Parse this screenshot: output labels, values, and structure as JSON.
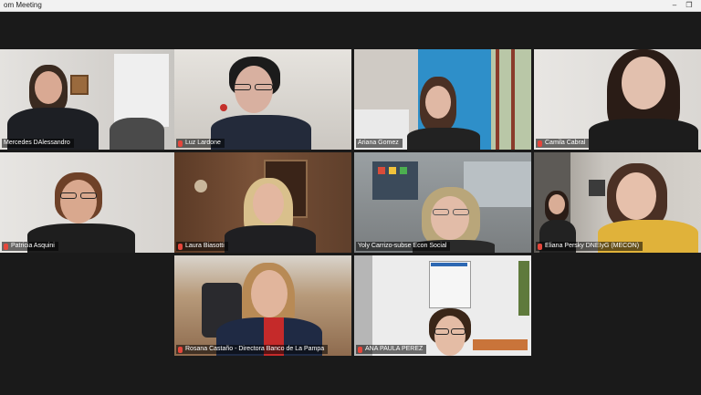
{
  "window": {
    "title": "om Meeting",
    "minimize": "–",
    "restore": "❐"
  },
  "participants": [
    {
      "name": "Mercedes DAlessandro"
    },
    {
      "name": "Luz Lardone"
    },
    {
      "name": "Ariana Gomez"
    },
    {
      "name": "Camila Cabral"
    },
    {
      "name": "Patricia Asquini"
    },
    {
      "name": "Laura Biasotti"
    },
    {
      "name": "Yoly Carrizo-subse Econ Social"
    },
    {
      "name": "Eliana Persky DNEIyG (MECON)"
    },
    {
      "name": "Rosana Castaño - Directora Banco de La Pampa"
    },
    {
      "name": "ANA PAULA PEREZ"
    }
  ],
  "colors": {
    "active_speaker_border": "#b7e04a",
    "muted_mic": "#e5463b",
    "background": "#1a1a1a"
  },
  "icons": {
    "mic_muted": "mic-muted-icon"
  }
}
